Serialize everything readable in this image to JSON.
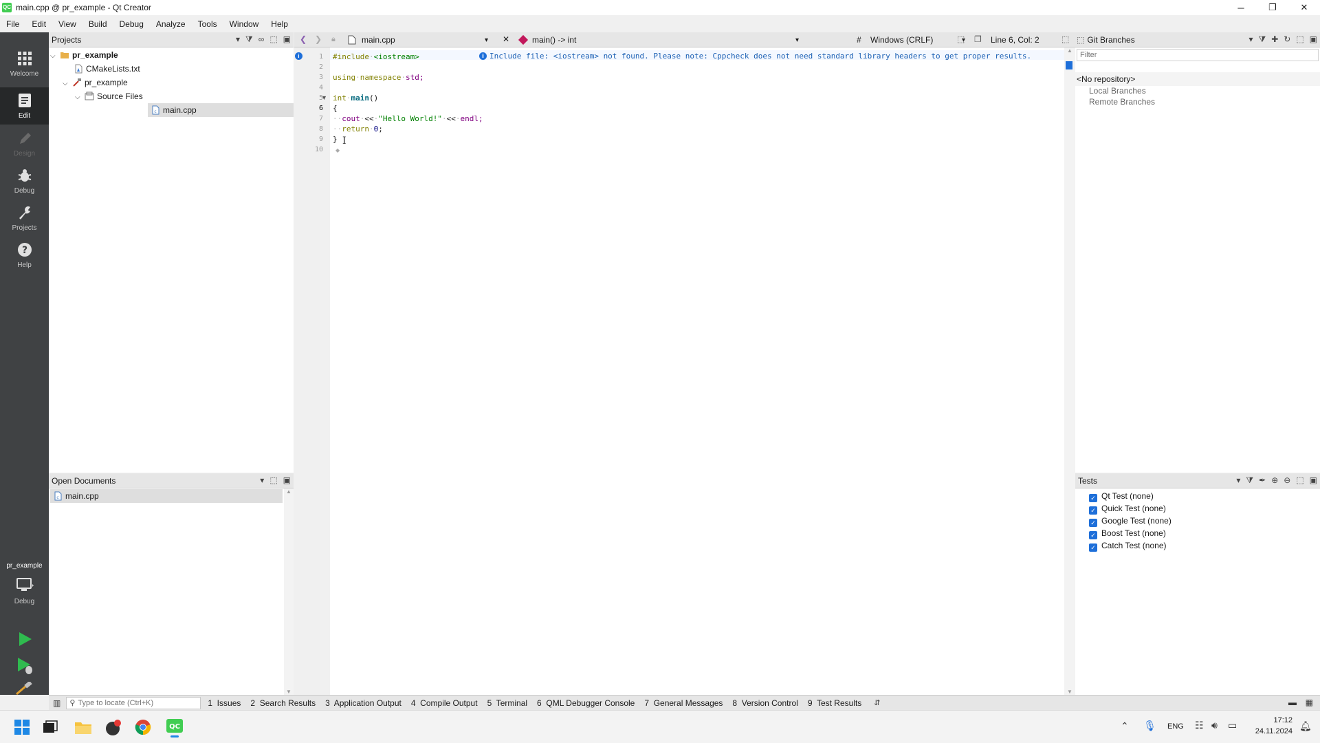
{
  "window": {
    "title": "main.cpp @ pr_example - Qt Creator",
    "app_icon": "QC",
    "controls": [
      "minimize-icon",
      "restore-icon",
      "close-icon"
    ]
  },
  "menu": [
    "File",
    "Edit",
    "View",
    "Build",
    "Debug",
    "Analyze",
    "Tools",
    "Window",
    "Help"
  ],
  "modes": [
    {
      "label": "Welcome",
      "icon": "grid-icon"
    },
    {
      "label": "Edit",
      "icon": "edit-icon"
    },
    {
      "label": "Design",
      "icon": "pen-icon"
    },
    {
      "label": "Debug",
      "icon": "bug-icon"
    },
    {
      "label": "Projects",
      "icon": "wrench-icon"
    },
    {
      "label": "Help",
      "icon": "help-icon"
    }
  ],
  "kit": {
    "project": "pr_example",
    "config": "Debug"
  },
  "projects_panel": {
    "title": "Projects",
    "tree": [
      {
        "label": "pr_example",
        "level": 0,
        "bold": true
      },
      {
        "label": "CMakeLists.txt",
        "level": 1
      },
      {
        "label": "pr_example",
        "level": 1
      },
      {
        "label": "Source Files",
        "level": 2
      },
      {
        "label": "main.cpp",
        "level": 3,
        "selected": true
      }
    ]
  },
  "open_documents": {
    "title": "Open Documents",
    "items": [
      "main.cpp"
    ]
  },
  "editor": {
    "file_tab": "main.cpp",
    "symbol": "main() -> int",
    "line_ending_hash": "#",
    "line_ending": "Windows (CRLF)",
    "position": "Line 6, Col: 2",
    "info_message": "Include file: <iostream> not found. Please note: Cppcheck does not need standard library headers to get proper results.",
    "line_numbers": [
      "1",
      "2",
      "3",
      "4",
      "5",
      "6",
      "7",
      "8",
      "9",
      "10"
    ],
    "code": {
      "l1_a": "#include",
      "l1_b": "<iostream>",
      "l3_a": "using",
      "l3_b": "namespace",
      "l3_c": "std;",
      "l5_a": "int",
      "l5_b": "main",
      "l5_c": "()",
      "l6": "{",
      "l7_a": "cout",
      "l7_b": "<<",
      "l7_c": "\"Hello World!\"",
      "l7_d": "<<",
      "l7_e": "endl;",
      "l8_a": "return",
      "l8_b": "0",
      "l8_c": ";",
      "l9": "}"
    }
  },
  "git_panel": {
    "title": "Git Branches",
    "filter_placeholder": "Filter",
    "no_repo": "<No repository>",
    "local": "Local Branches",
    "remote": "Remote Branches"
  },
  "tests_panel": {
    "title": "Tests",
    "items": [
      "Qt Test (none)",
      "Quick Test (none)",
      "Google Test (none)",
      "Boost Test (none)",
      "Catch Test (none)"
    ]
  },
  "bottom": {
    "locator_placeholder": "Type to locate (Ctrl+K)",
    "panes": [
      "1  Issues",
      "2  Search Results",
      "3  Application Output",
      "4  Compile Output",
      "5  Terminal",
      "6  QML Debugger Console",
      "7  General Messages",
      "8  Version Control",
      "9  Test Results"
    ]
  },
  "taskbar": {
    "lang": "ENG",
    "time": "17:12",
    "date": "24.11.2024"
  },
  "colors": {
    "modebar": "#404244",
    "accent": "#1e6fd9",
    "qt_green": "#41cd52"
  }
}
